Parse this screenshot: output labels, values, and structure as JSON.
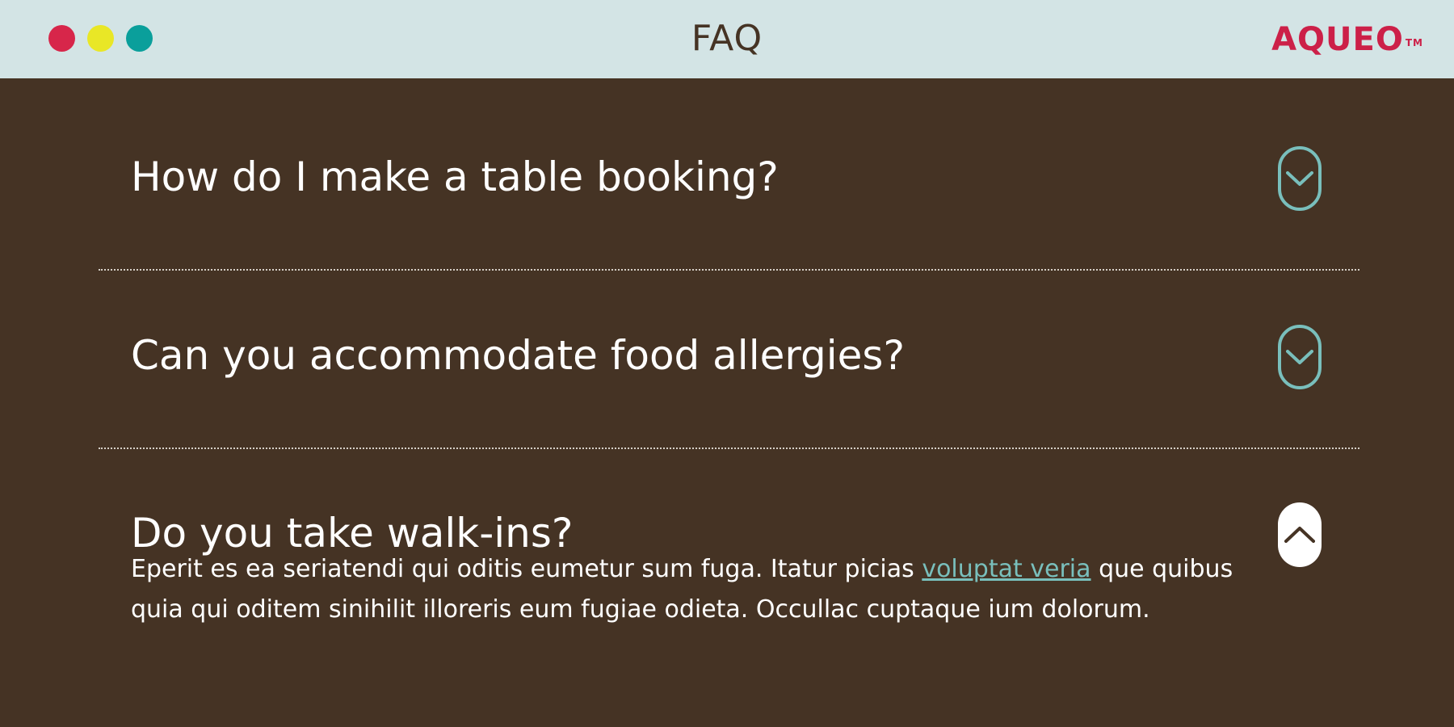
{
  "window": {
    "title": "FAQ",
    "brand": "AQUEO",
    "brand_mark": "TM",
    "traffic_lights": [
      "#d7264a",
      "#e9e726",
      "#0a9f9b"
    ]
  },
  "colors": {
    "header_bg": "#d3e4e5",
    "content_bg": "#453324",
    "brand": "#cc2048",
    "accent": "#79bfbc",
    "text": "#ffffff"
  },
  "faq": [
    {
      "question": "How do I make a table booking?",
      "state": "collapsed",
      "toggle_icon": "chevron-down-icon"
    },
    {
      "question": "Can you accommodate food allergies?",
      "state": "collapsed",
      "toggle_icon": "chevron-down-icon"
    },
    {
      "question": "Do you take walk-ins?",
      "state": "expanded",
      "toggle_icon": "chevron-up-icon",
      "answer": {
        "text_before": "Eperit es ea seriatendi qui oditis eumetur sum fuga. Itatur picias ",
        "link": "voluptat veria",
        "text_after": " que quibus quia qui oditem sinihilit illoreris eum fugiae odieta. Occullac cuptaque ium dolorum."
      }
    }
  ]
}
